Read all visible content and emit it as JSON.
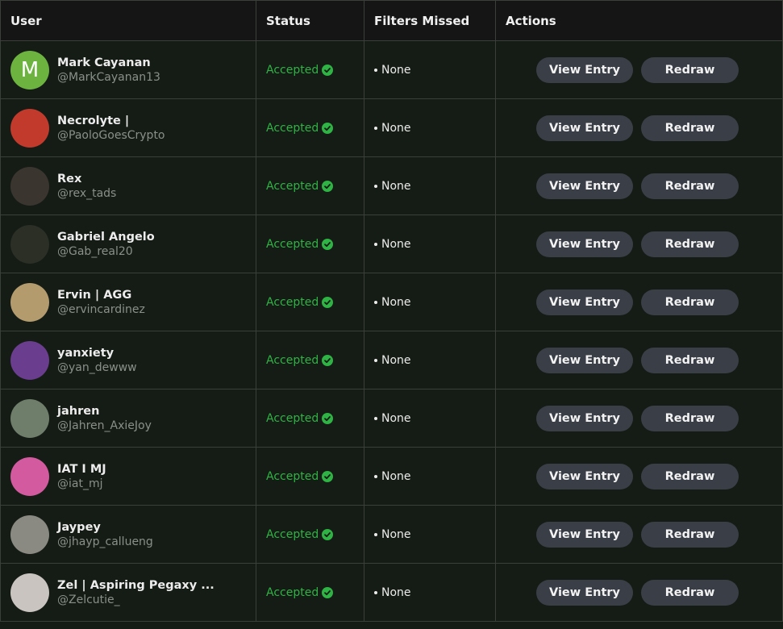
{
  "header": {
    "user": "User",
    "status": "Status",
    "filters_missed": "Filters Missed",
    "actions": "Actions"
  },
  "colors": {
    "accepted": "#2fb344",
    "row_bg": "#151c15",
    "button_bg": "#3a3f47"
  },
  "rows": [
    {
      "name": "Mark Cayanan",
      "handle": "@MarkCayanan13",
      "status": "Accepted",
      "filter": "None",
      "view": "View Entry",
      "redraw": "Redraw",
      "avatar_initial": "M",
      "avatar_color": "#6cb33f"
    },
    {
      "name": "Necrolyte |",
      "handle": "@PaoloGoesCrypto",
      "status": "Accepted",
      "filter": "None",
      "view": "View Entry",
      "redraw": "Redraw",
      "avatar_initial": "",
      "avatar_color": "#c23a2c"
    },
    {
      "name": "Rex",
      "handle": "@rex_tads",
      "status": "Accepted",
      "filter": "None",
      "view": "View Entry",
      "redraw": "Redraw",
      "avatar_initial": "",
      "avatar_color": "#3b3530"
    },
    {
      "name": "Gabriel Angelo",
      "handle": "@Gab_real20",
      "status": "Accepted",
      "filter": "None",
      "view": "View Entry",
      "redraw": "Redraw",
      "avatar_initial": "",
      "avatar_color": "#2b2f26"
    },
    {
      "name": "Ervin | AGG",
      "handle": "@ervincardinez",
      "status": "Accepted",
      "filter": "None",
      "view": "View Entry",
      "redraw": "Redraw",
      "avatar_initial": "",
      "avatar_color": "#b39b6e"
    },
    {
      "name": "yanxiety",
      "handle": "@yan_dewww",
      "status": "Accepted",
      "filter": "None",
      "view": "View Entry",
      "redraw": "Redraw",
      "avatar_initial": "",
      "avatar_color": "#6a3d8f"
    },
    {
      "name": "jahren",
      "handle": "@Jahren_AxieJoy",
      "status": "Accepted",
      "filter": "None",
      "view": "View Entry",
      "redraw": "Redraw",
      "avatar_initial": "",
      "avatar_color": "#6f7e6a"
    },
    {
      "name": "IAT I MJ",
      "handle": "@iat_mj",
      "status": "Accepted",
      "filter": "None",
      "view": "View Entry",
      "redraw": "Redraw",
      "avatar_initial": "",
      "avatar_color": "#d45aa0"
    },
    {
      "name": "Jaypey",
      "handle": "@jhayp_callueng",
      "status": "Accepted",
      "filter": "None",
      "view": "View Entry",
      "redraw": "Redraw",
      "avatar_initial": "",
      "avatar_color": "#8a8a82"
    },
    {
      "name": "Zel | Aspiring Pegaxy ...",
      "handle": "@Zelcutie_",
      "status": "Accepted",
      "filter": "None",
      "view": "View Entry",
      "redraw": "Redraw",
      "avatar_initial": "",
      "avatar_color": "#c9c4c0"
    }
  ]
}
